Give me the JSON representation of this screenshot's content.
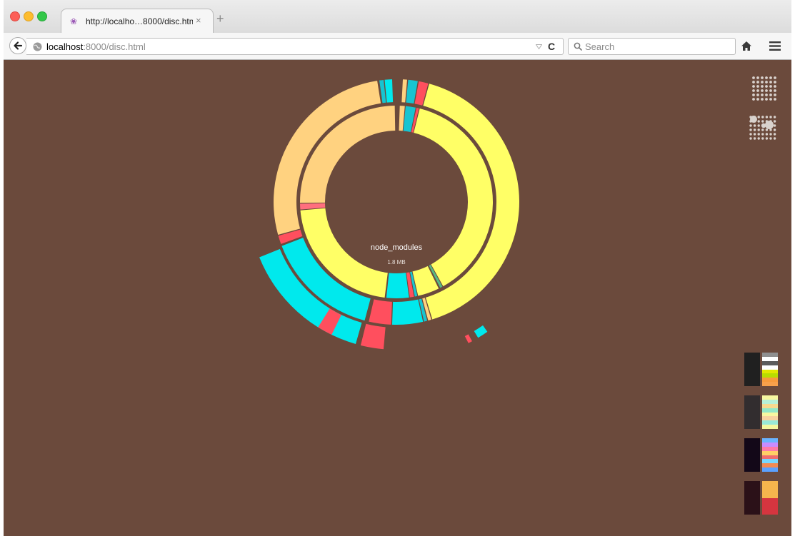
{
  "browser": {
    "tab_title": "http://localho…8000/disc.html",
    "tab_close": "×",
    "new_tab": "+",
    "url_host": "localhost",
    "url_rest": ":8000/disc.html",
    "reload": "C",
    "search_placeholder": "Search",
    "icons": [
      "back-arrow-icon",
      "globe-icon",
      "dropmarker-icon",
      "reload-icon",
      "search-icon",
      "home-icon",
      "hamburger-menu-icon"
    ]
  },
  "center": {
    "label": "node_modules",
    "size": "1.8 MB"
  },
  "view_modes": [
    "grid-dots-icon",
    "cluster-dots-icon"
  ],
  "colors": {
    "background": "#6b4a3c",
    "yellow": "#ffff66",
    "peach": "#ffd280",
    "cyan": "#00e9ed",
    "teal": "#17c4d1",
    "red": "#ff4f5e",
    "pink": "#ff6f7e",
    "green": "#55b885"
  },
  "sunburst": [
    {
      "ring": 1,
      "start": 2,
      "end": 5,
      "color": "#ffd280"
    },
    {
      "ring": 1,
      "start": 5.5,
      "end": 11.5,
      "color": "#17c4d1"
    },
    {
      "ring": 1,
      "start": 12,
      "end": 13.5,
      "color": "#ff4f5e"
    },
    {
      "ring": 1,
      "start": 14,
      "end": 151,
      "color": "#ffff66"
    },
    {
      "ring": 1,
      "start": 151.5,
      "end": 153,
      "color": "#55b885"
    },
    {
      "ring": 1,
      "start": 154,
      "end": 167,
      "color": "#ffff66"
    },
    {
      "ring": 1,
      "start": 167.5,
      "end": 169,
      "color": "#17c4d1"
    },
    {
      "ring": 1,
      "start": 169.5,
      "end": 172,
      "color": "#ff4f5e"
    },
    {
      "ring": 1,
      "start": 172.5,
      "end": 186,
      "color": "#00e9ed"
    },
    {
      "ring": 1,
      "start": 187,
      "end": 265,
      "color": "#ffff66"
    },
    {
      "ring": 1,
      "start": 265.5,
      "end": 269,
      "color": "#ff6f7e"
    },
    {
      "ring": 1,
      "start": 269.5,
      "end": 359,
      "color": "#ffd280"
    },
    {
      "ring": 2,
      "start": 3,
      "end": 5,
      "color": "#ffd280"
    },
    {
      "ring": 2,
      "start": 5.5,
      "end": 10,
      "color": "#17c4d1"
    },
    {
      "ring": 2,
      "start": 10.5,
      "end": 15,
      "color": "#ff4f5e"
    },
    {
      "ring": 2,
      "start": 15.5,
      "end": 163,
      "color": "#ffff66"
    },
    {
      "ring": 2,
      "start": 163.5,
      "end": 165,
      "color": "#ffd280"
    },
    {
      "ring": 2,
      "start": 165.5,
      "end": 167,
      "color": "#17c4d1"
    },
    {
      "ring": 2,
      "start": 167.5,
      "end": 182,
      "color": "#00e9ed"
    },
    {
      "ring": 2,
      "start": 182.5,
      "end": 193,
      "color": "#ff4f5e"
    },
    {
      "ring": 2,
      "start": 195,
      "end": 249,
      "color": "#00e9ed"
    },
    {
      "ring": 2,
      "start": 250,
      "end": 254,
      "color": "#ff4f5e"
    },
    {
      "ring": 2,
      "start": 254.5,
      "end": 351,
      "color": "#ffd280"
    },
    {
      "ring": 2,
      "start": 352,
      "end": 354,
      "color": "#17c4d1"
    },
    {
      "ring": 2,
      "start": 354.5,
      "end": 358,
      "color": "#00e9ed"
    },
    {
      "ring": 3,
      "start": 196,
      "end": 248,
      "color": "#00e9ed"
    },
    {
      "ring": 3,
      "start": 206,
      "end": 212,
      "color": "#ff4f5e"
    },
    {
      "ring": 3,
      "start": 185,
      "end": 194,
      "color": "#ff4f5e"
    },
    {
      "ring": 4,
      "start": 145,
      "end": 149,
      "color": "#00e9ed"
    },
    {
      "ring": 4,
      "start": 151.5,
      "end": 153,
      "color": "#ff4f5e"
    },
    {
      "ring": 5,
      "start": 354,
      "end": 357,
      "color": "#00e9ed"
    },
    {
      "ring": 5,
      "start": 358.5,
      "end": 360,
      "color": "#ff4f5e"
    }
  ],
  "themes": [
    {
      "bg": "#202020",
      "stripes": [
        "#8f8f8f",
        "#ffffff",
        "#5c5c5c",
        "#ffffff",
        "#e2e600",
        "#b8dc00",
        "#f79a3c",
        "#f7a04b"
      ]
    },
    {
      "bg": "#322d2f",
      "stripes": [
        "#f7f7a0",
        "#b6f0d8",
        "#f7d98f",
        "#93e8c8",
        "#f7f7a0",
        "#f8d3a0",
        "#9be9d8",
        "#f7f7a0"
      ]
    },
    {
      "bg": "#130818",
      "stripes": [
        "#6ab4ff",
        "#c98cff",
        "#ff7aa8",
        "#ffd166",
        "#ef6f6f",
        "#76d7ff",
        "#f28a53",
        "#5aa1ff"
      ]
    },
    {
      "bg": "#2b1118",
      "stripes": [
        "#f5b54d",
        "#f5b54d",
        "#f5b54d",
        "#f5b54d",
        "#d6353f",
        "#d6353f",
        "#d6353f",
        "#d6353f"
      ]
    }
  ]
}
